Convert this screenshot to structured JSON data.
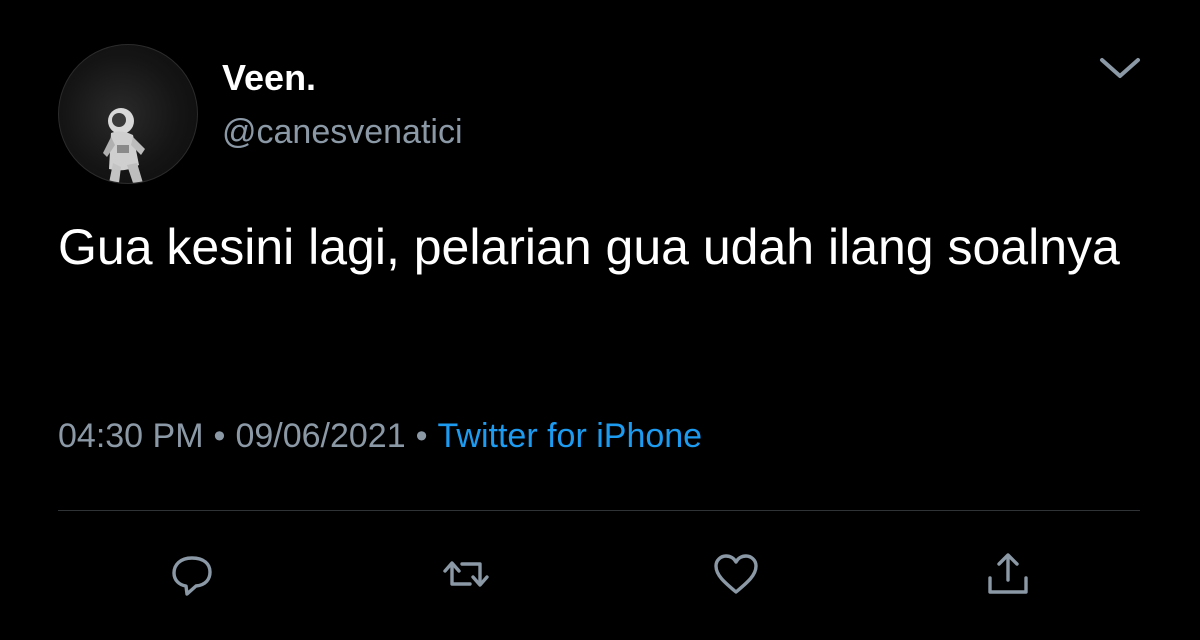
{
  "user": {
    "display_name": "Veen.",
    "handle": "@canesvenatici"
  },
  "tweet": {
    "text": "Gua kesini lagi, pelarian gua udah ilang soalnya",
    "time": "04:30 PM",
    "separator": "•",
    "date": "09/06/2021",
    "source": "Twitter for iPhone"
  },
  "icons": {
    "more": "chevron-down-icon",
    "reply": "reply-bubble-icon",
    "retweet": "retweet-icon",
    "like": "heart-icon",
    "share": "share-upload-icon"
  },
  "colors": {
    "background": "#000000",
    "text": "#ffffff",
    "muted": "#8b98a5",
    "link": "#1d9bf0",
    "divider": "#2f3336"
  }
}
